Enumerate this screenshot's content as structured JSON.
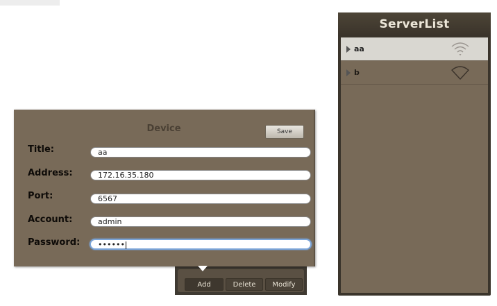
{
  "device": {
    "title": "Device",
    "save_label": "Save",
    "fields": [
      {
        "label": "Title:",
        "value": "aa"
      },
      {
        "label": "Address:",
        "value": "172.16.35.180"
      },
      {
        "label": "Port:",
        "value": "6567"
      },
      {
        "label": "Account:",
        "value": "admin"
      },
      {
        "label": "Password:",
        "value": "••••••"
      }
    ]
  },
  "toolbar": {
    "add_label": "Add",
    "delete_label": "Delete",
    "modify_label": "Modify"
  },
  "server_list": {
    "title": "ServerList",
    "items": [
      {
        "name": "aa",
        "status": "wifi-icon",
        "selected": true
      },
      {
        "name": "b",
        "status": "wifi-off-icon",
        "selected": false
      }
    ]
  }
}
